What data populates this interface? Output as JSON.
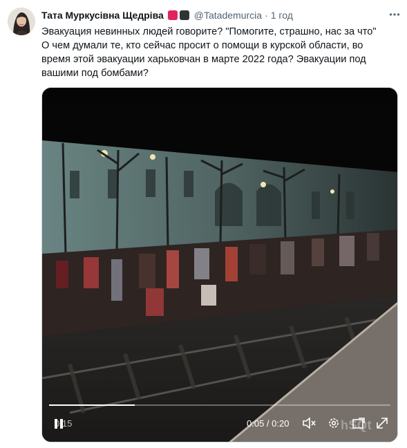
{
  "author": {
    "name": "Тата Муркусівна Щедріва",
    "handle": "@Tatademurcia",
    "time": "1 год",
    "separator": "·"
  },
  "badges": [
    {
      "name": "red-square-badge",
      "color": "#e0245e"
    },
    {
      "name": "dark-square-badge",
      "color": "#2f3336"
    }
  ],
  "tweet": {
    "line1": "Эвакуация невинных людей говорите? \"Помогите, страшно, нас за что\"",
    "line2": "О чем думали те, кто сейчас просит о помощи в курской области, во время этой эвакуации харьковчан в марте 2022 года? Эвакуации под вашими под бомбами?"
  },
  "video": {
    "elapsed_left": "0:15",
    "time_display": "0:05 / 0:20",
    "progress": 0.25,
    "watermark": "hSQt"
  },
  "colors": {
    "text": "#0f1419",
    "muted": "#536471",
    "media_border": "#cfd9de"
  }
}
